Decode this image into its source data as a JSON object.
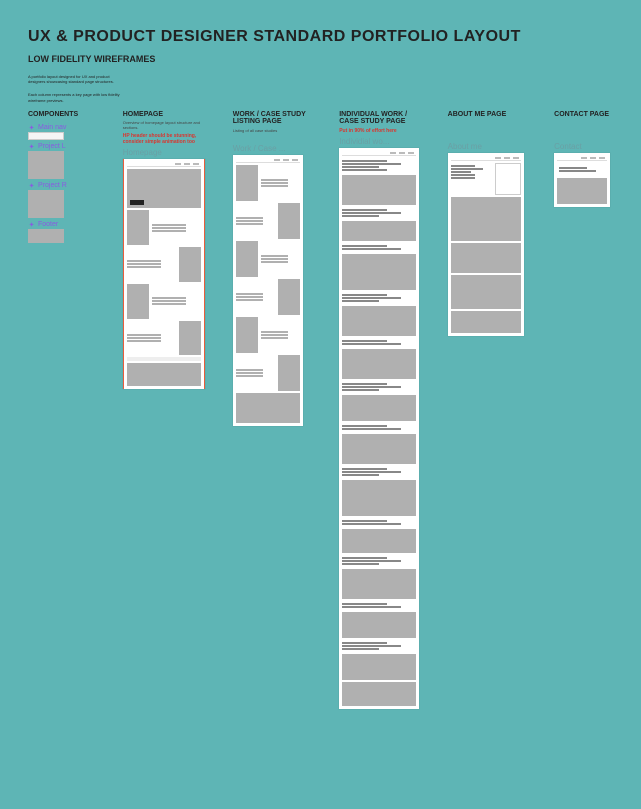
{
  "title": "UX & Product Designer Standard Portfolio Layout",
  "subtitle": "Low Fidelity wireframes",
  "desc1": "A portfolio layout designed for UX and product designers showcasing standard page structures.",
  "desc2": "Each column represents a key page with low fidelity wireframe previews.",
  "columns": {
    "components": {
      "title": "Components",
      "items": [
        {
          "label": "Main nav"
        },
        {
          "label": "Project L"
        },
        {
          "label": "Project R"
        },
        {
          "label": "Footer"
        }
      ]
    },
    "homepage": {
      "title": "Homepage",
      "desc": "Overview of homepage layout structure and sections.",
      "red": "HP header should be stunning, consider simple animation too",
      "frame": "Homepage"
    },
    "work": {
      "title": "Work / Case Study Listing page",
      "desc": "Listing of all case studies",
      "frame": "Work / Case ..."
    },
    "individual": {
      "title": "Individual Work / Case Study  page",
      "red": "Put in 90% of effort here",
      "frame": "Individial wo..."
    },
    "about": {
      "title": "About Me page",
      "frame": "About me"
    },
    "contact": {
      "title": "Contact page",
      "frame": "Contact"
    }
  }
}
